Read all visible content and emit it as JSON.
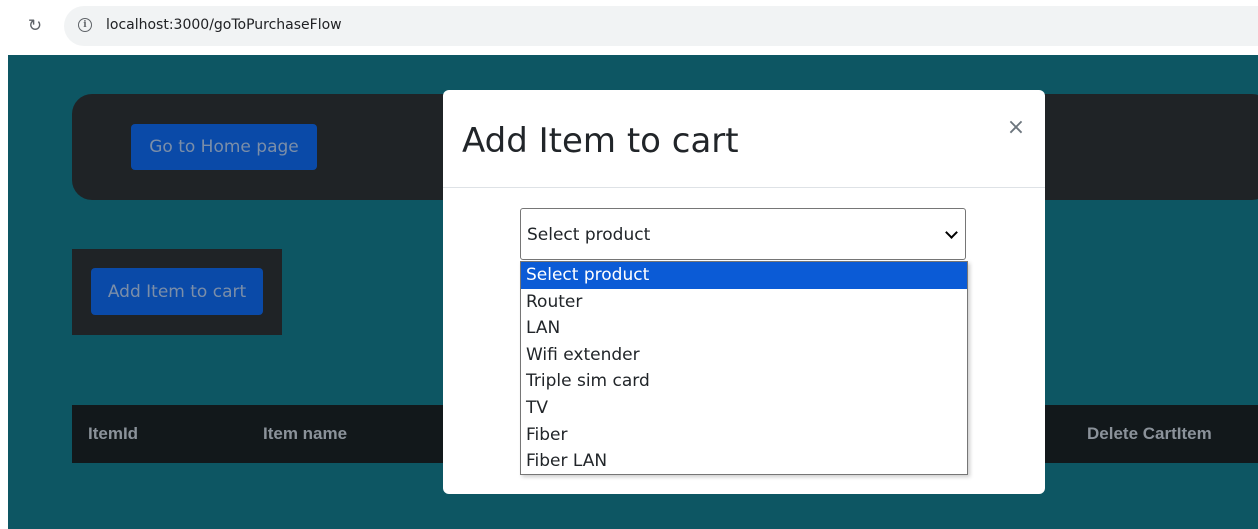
{
  "browser": {
    "url": "localhost:3000/goToPurchaseFlow",
    "reload_icon": "reload-icon",
    "info_icon": "info-icon"
  },
  "page": {
    "home_button_label": "Go to Home page",
    "add_item_button_label": "Add Item to cart",
    "table_headers": [
      "ItemId",
      "Item name",
      "Delete CartItem"
    ]
  },
  "modal": {
    "title": "Add Item to cart",
    "close_label": "×",
    "select_value": "Select product",
    "options": [
      "Select product",
      "Router",
      "LAN",
      "Wifi extender",
      "Triple sim card",
      "TV",
      "Fiber",
      "Fiber LAN"
    ],
    "selected_index": 0
  },
  "colors": {
    "page_bg": "#0d5663",
    "dark_panel": "#1f2326",
    "button_blue": "#0a4aa8",
    "option_highlight": "#0b5bd6"
  }
}
